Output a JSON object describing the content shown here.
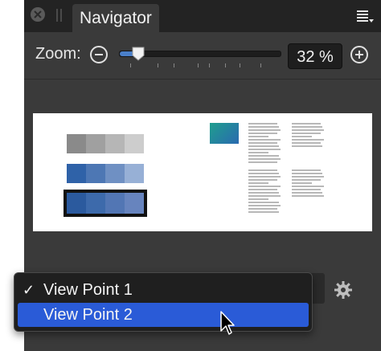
{
  "tab": {
    "title": "Navigator"
  },
  "zoom": {
    "label": "Zoom:",
    "value_text": "32 %",
    "slider_fraction": 0.15
  },
  "icons": {
    "close": "close-icon",
    "grip": "grip-icon",
    "menu": "panel-menu-icon",
    "zoom_out": "minus-circle-icon",
    "zoom_in": "plus-circle-icon",
    "settings": "gear-icon",
    "cursor": "pointer-cursor-icon"
  },
  "viewpoints": {
    "items": [
      {
        "label": "View Point 1",
        "checked": true,
        "check_mark": "✓"
      },
      {
        "label": "View Point 2",
        "checked": false,
        "check_mark": ""
      }
    ]
  },
  "colors": {
    "selection": "#2a5bd7",
    "gray_swatches": [
      "#8a8a8a",
      "#a0a0a0",
      "#b6b6b6",
      "#cdcdcd"
    ],
    "blue_swatches": [
      "#2f62a8",
      "#4d77b4",
      "#6f90c3",
      "#97b0d6"
    ],
    "dark_blue_swatches": [
      "#2b5a9e",
      "#3d6aab",
      "#5276b4",
      "#6784be"
    ],
    "teal_swatch": [
      "#1f9e8e",
      "#2a6ab0"
    ]
  }
}
